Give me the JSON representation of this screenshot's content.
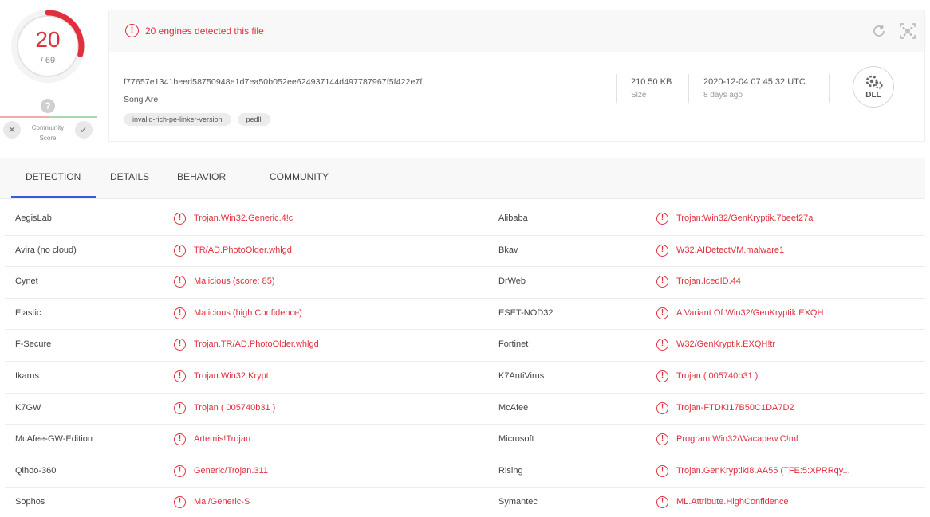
{
  "score": {
    "detected": "20",
    "total": "/ 69",
    "fraction": 0.29,
    "accent_color": "#e0303e"
  },
  "community": {
    "label_line1": "Community",
    "label_line2": "Score",
    "question_glyph": "?",
    "down_glyph": "✕",
    "up_glyph": "✓"
  },
  "alert": {
    "icon_glyph": "!",
    "text": "20 engines detected this file"
  },
  "file": {
    "hash": "f77657e1341beed58750948e1d7ea50b052ee624937144d497787967f5f422e7f",
    "name": "Song Are",
    "tags": [
      "invalid-rich-pe-linker-version",
      "pedll"
    ],
    "size_value": "210.50 KB",
    "size_label": "Size",
    "date_value": "2020-12-04 07:45:32 UTC",
    "date_label": "8 days ago",
    "type_badge": "DLL"
  },
  "tabs": [
    "DETECTION",
    "DETAILS",
    "BEHAVIOR",
    "COMMUNITY"
  ],
  "detections": [
    {
      "left": {
        "engine": "AegisLab",
        "result": "Trojan.Win32.Generic.4!c"
      },
      "right": {
        "engine": "Alibaba",
        "result": "Trojan:Win32/GenKryptik.7beef27a"
      }
    },
    {
      "left": {
        "engine": "Avira (no cloud)",
        "result": "TR/AD.PhotoOlder.whlgd"
      },
      "right": {
        "engine": "Bkav",
        "result": "W32.AIDetectVM.malware1"
      }
    },
    {
      "left": {
        "engine": "Cynet",
        "result": "Malicious (score: 85)"
      },
      "right": {
        "engine": "DrWeb",
        "result": "Trojan.IcedID.44"
      }
    },
    {
      "left": {
        "engine": "Elastic",
        "result": "Malicious (high Confidence)"
      },
      "right": {
        "engine": "ESET-NOD32",
        "result": "A Variant Of Win32/GenKryptik.EXQH"
      }
    },
    {
      "left": {
        "engine": "F-Secure",
        "result": "Trojan.TR/AD.PhotoOlder.whlgd"
      },
      "right": {
        "engine": "Fortinet",
        "result": "W32/GenKryptik.EXQH!tr"
      }
    },
    {
      "left": {
        "engine": "Ikarus",
        "result": "Trojan.Win32.Krypt"
      },
      "right": {
        "engine": "K7AntiVirus",
        "result": "Trojan ( 005740b31 )"
      }
    },
    {
      "left": {
        "engine": "K7GW",
        "result": "Trojan ( 005740b31 )"
      },
      "right": {
        "engine": "McAfee",
        "result": "Trojan-FTDK!17B50C1DA7D2"
      }
    },
    {
      "left": {
        "engine": "McAfee-GW-Edition",
        "result": "Artemis!Trojan"
      },
      "right": {
        "engine": "Microsoft",
        "result": "Program:Win32/Wacapew.C!ml"
      }
    },
    {
      "left": {
        "engine": "Qihoo-360",
        "result": "Generic/Trojan.311"
      },
      "right": {
        "engine": "Rising",
        "result": "Trojan.GenKryptik!8.AA55 (TFE:5:XPRRqy..."
      }
    },
    {
      "left": {
        "engine": "Sophos",
        "result": "Mal/Generic-S"
      },
      "right": {
        "engine": "Symantec",
        "result": "ML.Attribute.HighConfidence"
      }
    }
  ]
}
